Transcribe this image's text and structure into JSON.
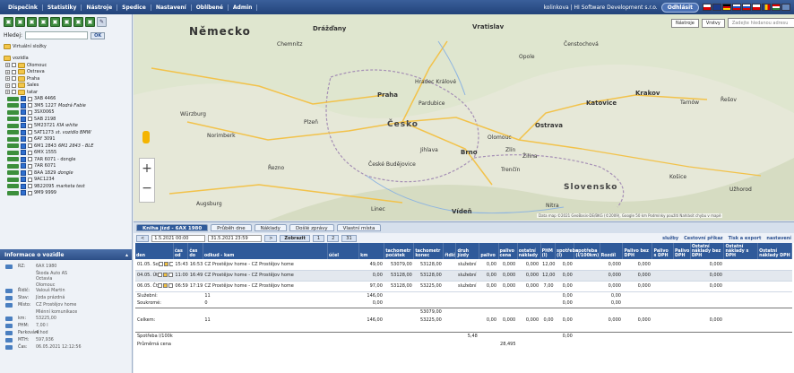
{
  "topbar": {
    "menu": [
      "Dispečink",
      "Statistiky",
      "Nástroje",
      "Spedice",
      "Nastavení",
      "Oblíbené",
      "Admin"
    ],
    "user": "kolinkova | HI Software Development s.r.o.",
    "logout": "Odhlásit"
  },
  "sidebar": {
    "search_label": "Hledej:",
    "ok": "OK",
    "tree": [
      {
        "label": "Virtuální složky",
        "type": "folder"
      },
      {
        "label": "vozidla",
        "type": "folder"
      },
      {
        "label": "Olomouc",
        "type": "group"
      },
      {
        "label": "Ostrava",
        "type": "group"
      },
      {
        "label": "Praha",
        "type": "group"
      },
      {
        "label": "Sales",
        "type": "group"
      },
      {
        "label": "tatar",
        "type": "group"
      },
      {
        "label": "3AB 4466",
        "type": "vehicle"
      },
      {
        "label": "3M5 1227",
        "note": "Modrá Fabie",
        "type": "vehicle"
      },
      {
        "label": "3SX0065",
        "type": "vehicle"
      },
      {
        "label": "5AB 2198",
        "type": "vehicle"
      },
      {
        "label": "5M23721",
        "note": "KIA white",
        "type": "vehicle"
      },
      {
        "label": "5AT1273",
        "note": "st. vozidlo BMW",
        "type": "vehicle"
      },
      {
        "label": "6AY 3091",
        "type": "vehicle"
      },
      {
        "label": "6M1 2843",
        "note": "6M1 2843 - BLE",
        "type": "vehicle"
      },
      {
        "label": "6MX 1555",
        "type": "vehicle"
      },
      {
        "label": "7AR 6071 - dongle",
        "type": "vehicle"
      },
      {
        "label": "7AR 6071",
        "type": "vehicle"
      },
      {
        "label": "8AA 1829",
        "note": "dongle",
        "type": "vehicle"
      },
      {
        "label": "9AC1234",
        "type": "vehicle"
      },
      {
        "label": "9B22095",
        "note": "marketa test",
        "type": "vehicle"
      },
      {
        "label": "9M9 9999",
        "type": "vehicle"
      }
    ],
    "info_title": "Informace o vozidle",
    "info": [
      {
        "label": "RZ:",
        "value": "6AX 1980"
      },
      {
        "label": "",
        "value": "Škoda Auto AS"
      },
      {
        "label": "",
        "value": "Octavia"
      },
      {
        "label": "",
        "value": "Olomouc"
      },
      {
        "label": "Řidič:",
        "value": "Valouš Martin"
      },
      {
        "label": "Stav:",
        "value": "Jízda prázdná"
      },
      {
        "label": "Místo:",
        "value": "CZ Prostějov home"
      },
      {
        "label": "",
        "value": "Mlénní komunikace"
      },
      {
        "label": "km:",
        "value": "53225,00"
      },
      {
        "label": "PHM:",
        "value": "7,00 l"
      },
      {
        "label": "Parkování:",
        "value": "4 hod"
      },
      {
        "label": "MTH:",
        "value": "597,936"
      },
      {
        "label": "Čas:",
        "value": "06.05.2021 12:12:56"
      }
    ]
  },
  "map": {
    "btn_tools": "Nástroje",
    "btn_layers": "Vrstvy",
    "search_placeholder": "Zadejte hledanou adresu",
    "labels": {
      "germany": "Německo",
      "czech": "Česko",
      "slovakia": "Slovensko",
      "dresden": "Drážďany",
      "praha": "Praha",
      "brno": "Brno",
      "ostrava": "Ostrava",
      "wroclaw": "Vratislav",
      "katowice": "Katovice",
      "krakow": "Krakov",
      "plzen": "Plzeň",
      "nuremberg": "Norimberk",
      "linz": "Linec",
      "vienna": "Vídeň",
      "olomouc": "Olomouc",
      "hradec": "Hradec Králové",
      "pardubice": "Pardubice",
      "kosice": "Košice",
      "zilina": "Žilina",
      "regensburg": "Řezno",
      "augsburg": "Augsburg",
      "wurzburg": "Würzburg",
      "chemnitz": "Chemnitz",
      "jihlava": "Jihlava",
      "ceske_budejovice": "České Budějovice",
      "zlin": "Zlín",
      "trencin": "Trenčín",
      "czestochowa": "Čenstochová",
      "opole": "Opole",
      "tarnow": "Tarnów",
      "rzeszow": "Řešov",
      "uzhhorod": "Užhorod",
      "nitra": "Nitra"
    },
    "attribution": "Data map ©2021 GeoBasis-DE/BKG (©2009), Google  50 km  Podmínky použití  Nahlásit chybu v mapě"
  },
  "panel": {
    "tabs": [
      "Kniha jízd - 6AX 1980",
      "Průběh dne",
      "Náklady",
      "Došlé zprávy",
      "Vlastní místa"
    ],
    "date_from": "1.5.2021 00:00",
    "date_to": "31.5.2021 23:59",
    "show_btn": "Zobrazit",
    "page_btns": [
      "1",
      "2",
      "31"
    ],
    "actions": [
      "služby",
      "Cestovní příkaz",
      "Tisk a export",
      "nastavení"
    ],
    "columns": [
      "den",
      "čas od",
      "čas do",
      "odkud - kam",
      "účel",
      "km",
      "tachometr počátek",
      "tachometr konec",
      "řidič",
      "druh jízdy",
      "palivo",
      "palivo cena",
      "ostatní náklady",
      "PHM (l)",
      "spotřeba (l)",
      "spotřeba (l/100km)",
      "Rozdíl",
      "Palivo bez DPH",
      "Palivo s DPH",
      "Palivo DPH",
      "Ostatní náklady bez DPH",
      "Ostatní náklady s DPH",
      "Ostatní náklady DPH"
    ],
    "rows": [
      {
        "den": "01.05. So",
        "od": "15:43",
        "do": "16:53",
        "trasa": "CZ Prostějov home - CZ Prostějov home",
        "km": "49,00",
        "tach_start": "53079,00",
        "tach_end": "53128,00",
        "druh": "služební",
        "palivo": "0,00",
        "cena": "0,000",
        "ostatni": "0,000",
        "phm": "12,00",
        "spotreba": "0,00",
        "rozdil": "0,000",
        "p_bez": "0,000",
        "o_bez": "0,000"
      },
      {
        "den": "04.05. Út",
        "od": "11:00",
        "do": "16:49",
        "trasa": "CZ Prostějov home - CZ Prostějov home",
        "km": "0,00",
        "tach_start": "53128,00",
        "tach_end": "53128,00",
        "druh": "služební",
        "palivo": "0,00",
        "cena": "0,000",
        "ostatni": "0,000",
        "phm": "12,00",
        "spotreba": "0,00",
        "rozdil": "0,000",
        "p_bez": "0,000",
        "o_bez": "0,000"
      },
      {
        "den": "06.05. Čt",
        "od": "06:59",
        "do": "17:19",
        "trasa": "CZ Prostějov home - CZ Prostějov home",
        "km": "97,00",
        "tach_start": "53128,00",
        "tach_end": "53225,00",
        "druh": "služební",
        "palivo": "0,00",
        "cena": "0,000",
        "ostatni": "0,000",
        "phm": "7,00",
        "spotreba": "0,00",
        "rozdil": "0,000",
        "p_bez": "0,000",
        "o_bez": "0,000"
      }
    ],
    "summary": {
      "sluzebni_label": "Služební:",
      "sluzebni_count": "11",
      "sluzebni_km": "146,00",
      "sluzebni_sp": "0,00",
      "sluzebni_sp2": "0,00",
      "soukrome_label": "Soukromé:",
      "soukrome_count": "0",
      "soukrome_km": "0,00",
      "soukrome_sp": "0,00",
      "soukrome_sp2": "0,00",
      "celkem_label": "Celkem:",
      "celkem_count": "11",
      "celkem_km": "146,00",
      "celkem_tach1": "53079,00",
      "celkem_tach2": "53225,00",
      "celkem_palivo": "0,00",
      "celkem_cena": "0,000",
      "celkem_ost": "0,000",
      "celkem_phm": "0,00",
      "celkem_sp": "0,00",
      "celkem_rozdil": "0,000",
      "celkem_pbez": "0,000",
      "celkem_obez": "0,000",
      "spotreba_label": "Spotřeba l/100km:",
      "spotreba_val": "5,48",
      "spotreba_val2": "0,00",
      "cena_label": "Průměrná cena PHM:",
      "cena_val": "28,495"
    }
  }
}
